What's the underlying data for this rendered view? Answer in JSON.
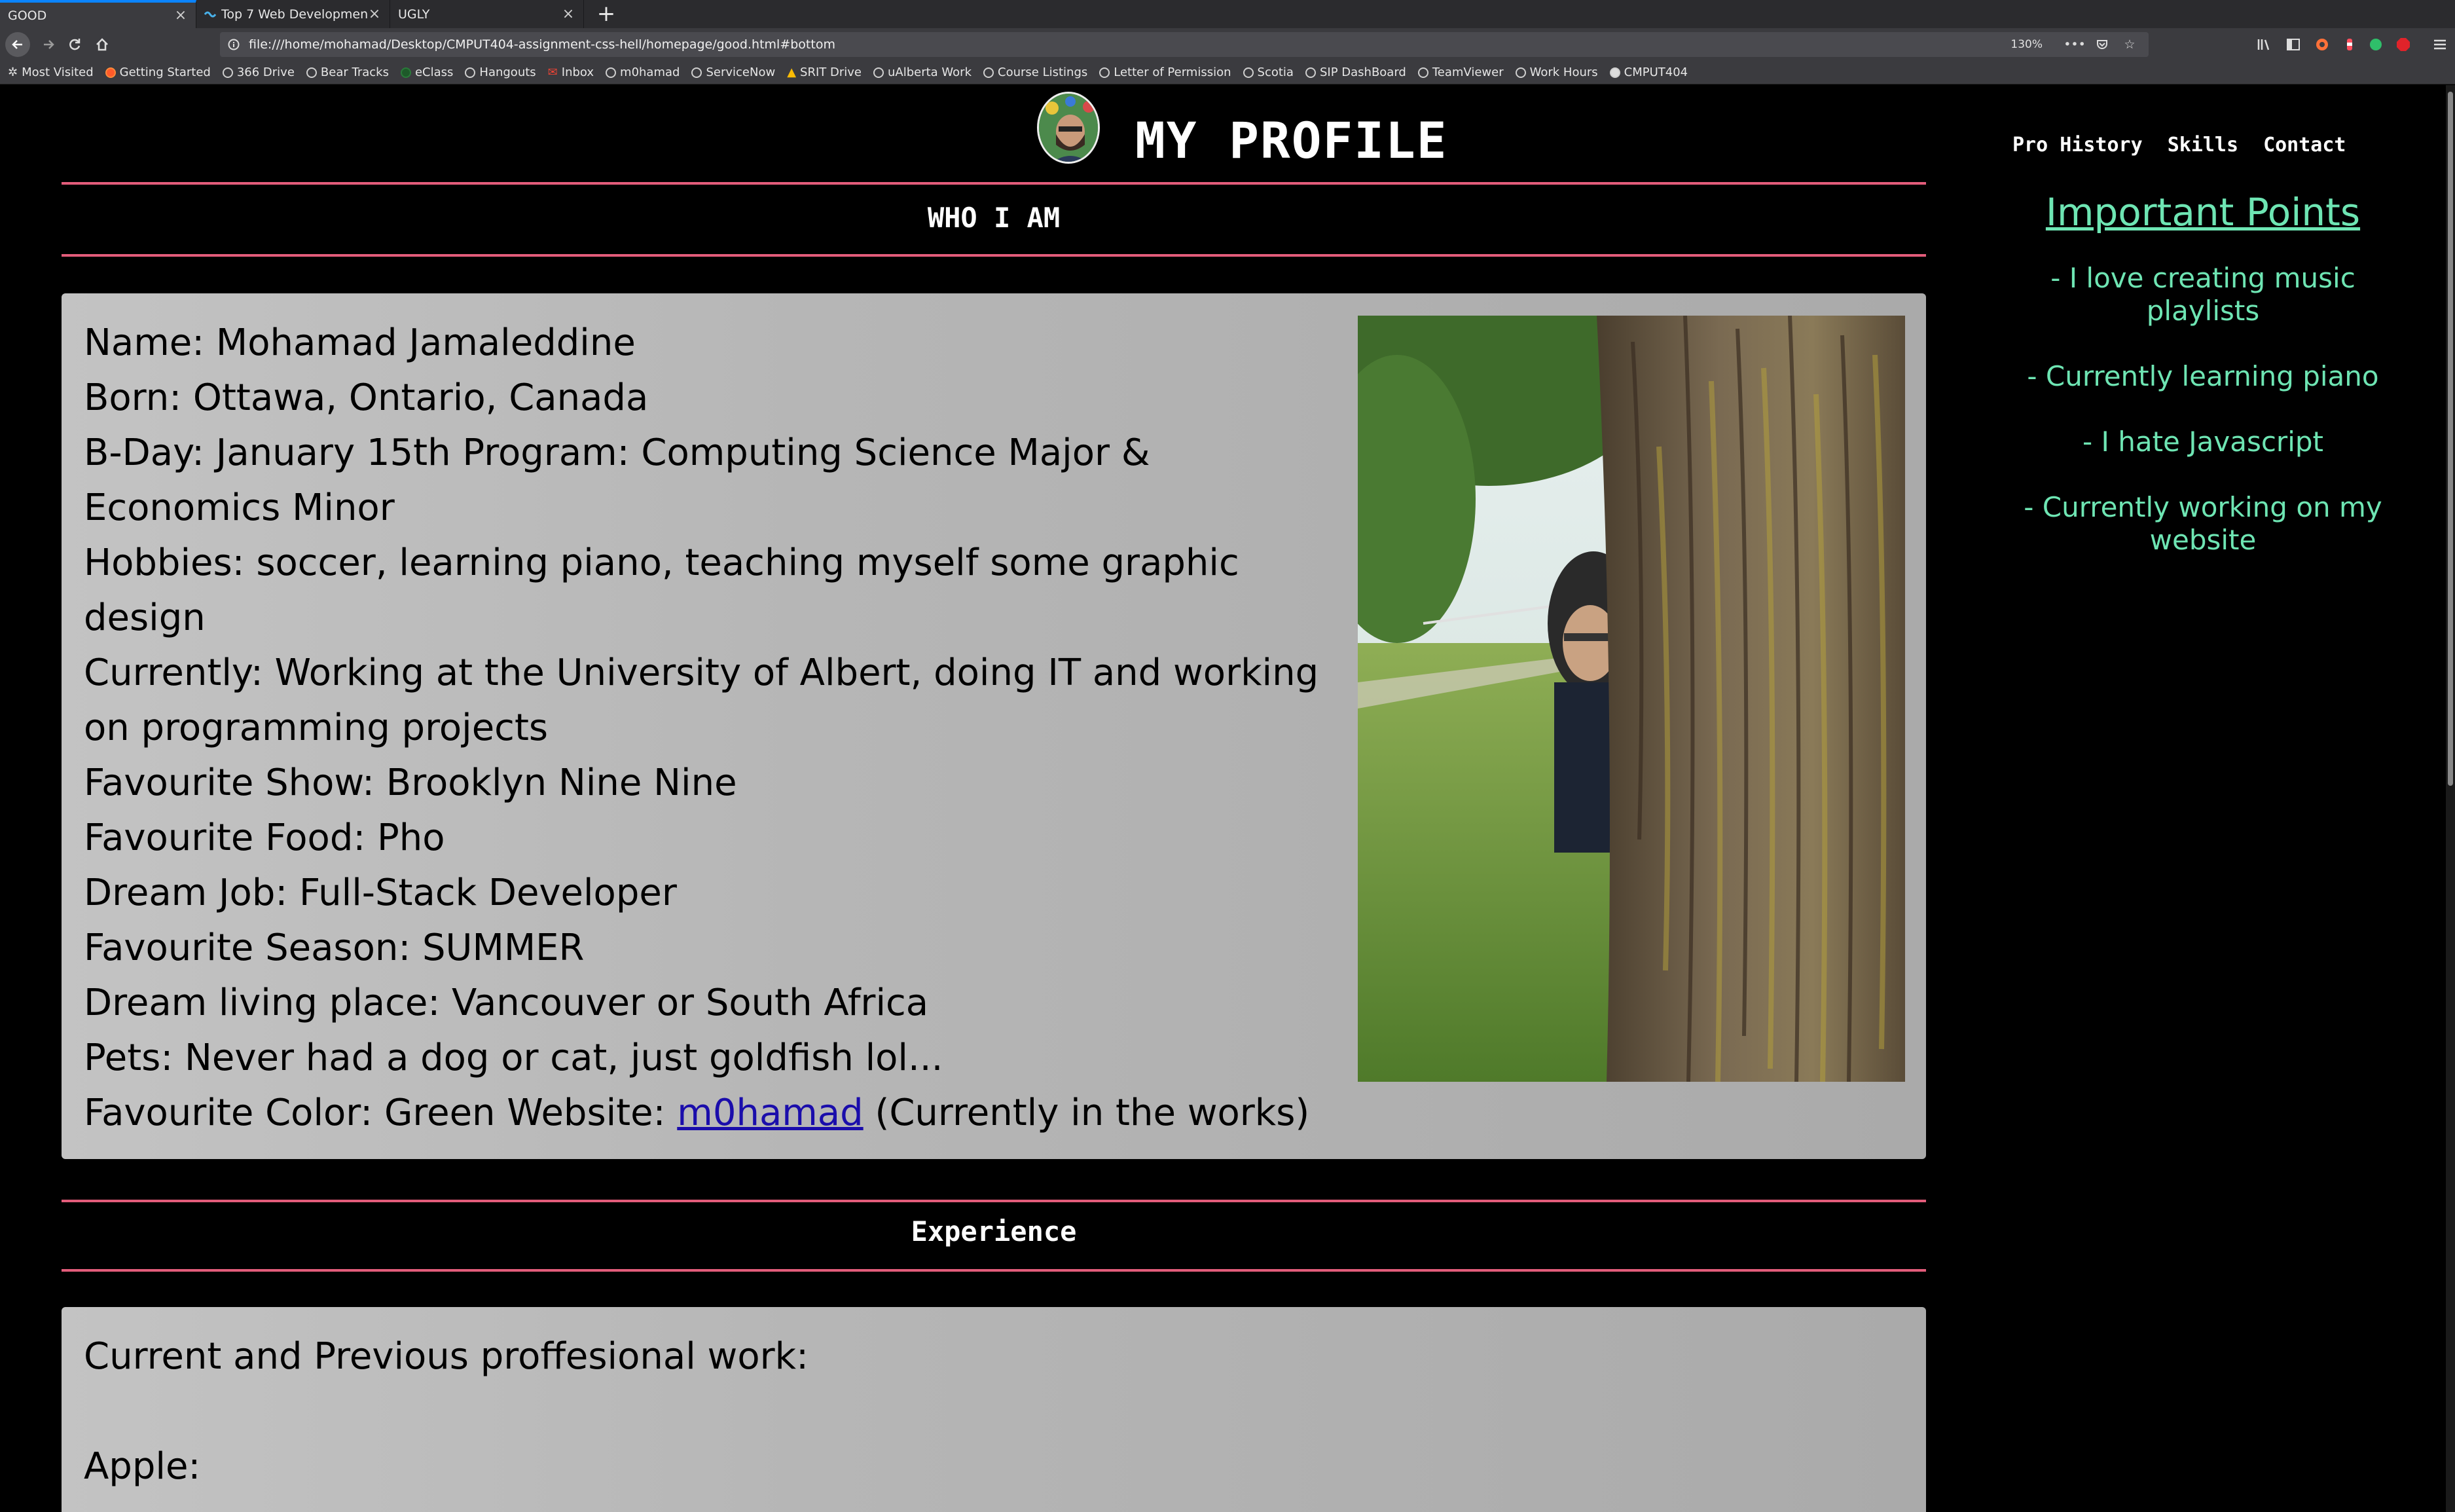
{
  "browser": {
    "tabs": [
      {
        "label": "GOOD",
        "active": true
      },
      {
        "label": "Top 7 Web Developmen",
        "active": false
      },
      {
        "label": "UGLY",
        "active": false
      }
    ],
    "url": "file:///home/mohamad/Desktop/CMPUT404-assignment-css-hell/homepage/good.html#bottom",
    "zoom": "130%",
    "bookmarks": [
      "Most Visited",
      "Getting Started",
      "366 Drive",
      "Bear Tracks",
      "eClass",
      "Hangouts",
      "Inbox",
      "m0hamad",
      "ServiceNow",
      "SRIT Drive",
      "uAlberta Work",
      "Course Listings",
      "Letter of Permission",
      "Scotia",
      "SIP DashBoard",
      "TeamViewer",
      "Work Hours",
      "CMPUT404"
    ]
  },
  "page": {
    "title": "MY PROFILE",
    "nav": [
      "Pro History",
      "Skills",
      "Contact"
    ],
    "who_title": "WHO I AM",
    "bio": {
      "name": "Name: Mohamad Jamaleddine",
      "born": "Born: Ottawa, Ontario, Canada",
      "bday": "B-Day: January 15th Program: Computing Science Major & Economics Minor",
      "hobbies": "Hobbies: soccer, learning piano, teaching myself some graphic design",
      "currently": "Currently: Working at the University of Albert, doing IT and working on programming projects",
      "show": "Favourite Show: Brooklyn Nine Nine",
      "food": "Favourite Food: Pho",
      "job": "Dream Job: Full-Stack Developer",
      "season": "Favourite Season: SUMMER",
      "living": "Dream living place: Vancouver or South Africa",
      "pets": "Pets: Never had a dog or cat, just goldfish lol...",
      "color_prefix": "Favourite Color: Green Website: ",
      "website_link": "m0hamad",
      "website_suffix": " (Currently in the works)"
    },
    "sidebar": {
      "heading": "Important Points",
      "points": [
        "- I love creating music playlists",
        "- Currently learning piano",
        "- I hate Javascript",
        "- Currently working on my website"
      ]
    },
    "experience_title": "Experience",
    "experience": {
      "intro": "Current and Previous proffesional work:",
      "first": "Apple:"
    }
  },
  "colors": {
    "divider": "#e25c7a",
    "sidebar_text": "#6ee5b3",
    "page_bg": "#000000",
    "card_bg": "#b8b8b8",
    "link": "#1a0dab"
  }
}
